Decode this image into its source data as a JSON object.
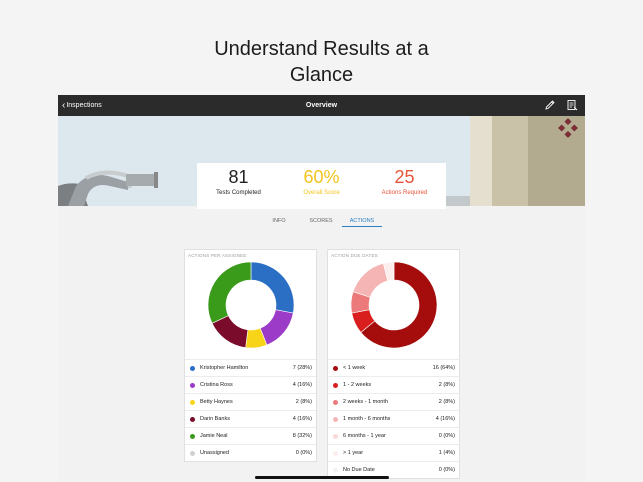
{
  "headline": {
    "line1": "Understand Results at a",
    "line2": "Glance"
  },
  "nav": {
    "back_label": "Inspections",
    "title": "Overview",
    "edit_icon": "pencil-icon",
    "report_icon": "report-icon"
  },
  "summary": [
    {
      "value": "81",
      "label": "Tests Completed",
      "color": "#222222"
    },
    {
      "value": "60%",
      "label": "Overall Score",
      "color": "#f2c51d"
    },
    {
      "value": "25",
      "label": "Actions Required",
      "color": "#e8553a"
    }
  ],
  "tabs": [
    {
      "label": "INFO",
      "active": false
    },
    {
      "label": "SCORES",
      "active": false
    },
    {
      "label": "ACTIONS",
      "active": true
    }
  ],
  "cards": [
    {
      "title": "ACTIONS PER ASSIGNEE",
      "chart_data": {
        "type": "pie",
        "series": [
          {
            "name": "Kristopher Hamilton",
            "count": "7 (28%)",
            "value": 7,
            "color": "#2a6fc4"
          },
          {
            "name": "Cristina Ross",
            "count": "4 (16%)",
            "value": 4,
            "color": "#9c3bc8"
          },
          {
            "name": "Betty Haynes",
            "count": "2 (8%)",
            "value": 2,
            "color": "#f7d417"
          },
          {
            "name": "Darin Banks",
            "count": "4 (16%)",
            "value": 4,
            "color": "#7a0b2a"
          },
          {
            "name": "Jamie Neal",
            "count": "8 (32%)",
            "value": 8,
            "color": "#3a9a1a"
          },
          {
            "name": "Unassigned",
            "count": "0 (0%)",
            "value": 0,
            "color": "#d0d0d0"
          }
        ]
      }
    },
    {
      "title": "ACTION DUE DATES",
      "chart_data": {
        "type": "pie",
        "series": [
          {
            "name": "< 1 week",
            "count": "16 (64%)",
            "value": 16,
            "color": "#a50d0d"
          },
          {
            "name": "1 - 2 weeks",
            "count": "2 (8%)",
            "value": 2,
            "color": "#d91e1e"
          },
          {
            "name": "2 weeks - 1 month",
            "count": "2 (8%)",
            "value": 2,
            "color": "#ec7a7a"
          },
          {
            "name": "1 month - 6 months",
            "count": "4 (16%)",
            "value": 4,
            "color": "#f5b5b5"
          },
          {
            "name": "6 months - 1 year",
            "count": "0 (0%)",
            "value": 0,
            "color": "#fbd9d9"
          },
          {
            "name": "> 1 year",
            "count": "1 (4%)",
            "value": 1,
            "color": "#fdeeee"
          },
          {
            "name": "No Due Date",
            "count": "0 (0%)",
            "value": 0,
            "color": "#f3f3f3"
          }
        ]
      }
    }
  ]
}
